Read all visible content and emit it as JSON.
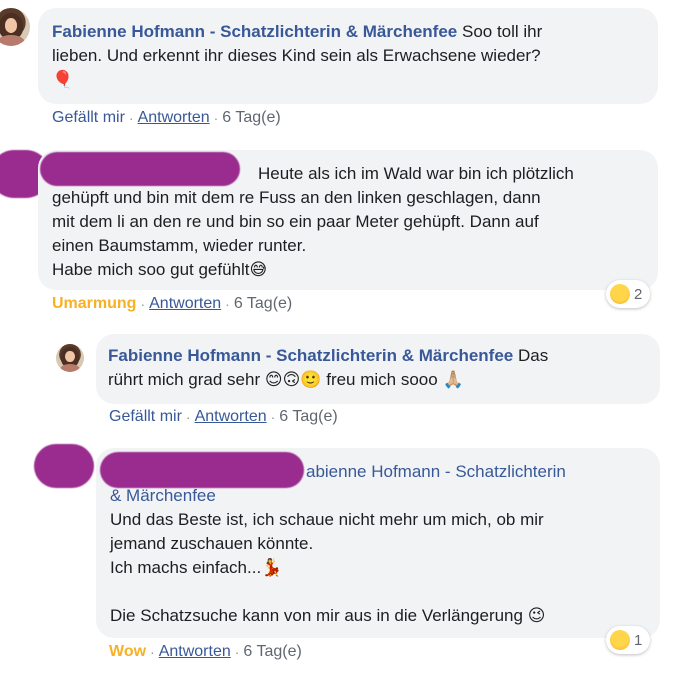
{
  "comments": [
    {
      "name": "Fabienne Hofmann - Schatzlichterin & Märchenfee",
      "text_line1": "Soo toll ihr",
      "text_line2": "lieben. Und erkennt ihr dieses Kind sein als Erwachsene wieder?",
      "emoji": "🎈",
      "reaction_label": "Gefällt mir",
      "reply_label": "Antworten",
      "time": "6 Tag(e)"
    },
    {
      "text_line1": "Heute als ich im Wald war bin ich plötzlich",
      "text_line2": "gehüpft und bin mit dem re Fuss an den linken geschlagen, dann",
      "text_line3": "mit dem li an den re und bin so ein paar Meter gehüpft. Dann auf",
      "text_line4": "einen Baumstamm, wieder runter.",
      "text_line5": "Habe mich soo gut gefühlt",
      "emoji": "😅",
      "reaction_label": "Umarmung",
      "reply_label": "Antworten",
      "time": "6 Tag(e)",
      "reaction_count": "2"
    },
    {
      "name": "Fabienne Hofmann - Schatzlichterin & Märchenfee",
      "text_line1": "Das",
      "text_line2_a": "rührt mich grad sehr",
      "emojis_a": "😊🙃🙂",
      "text_line2_b": "freu mich sooo",
      "emoji_b": "🙏🏼",
      "reaction_label": "Gefällt mir",
      "reply_label": "Antworten",
      "time": "6 Tag(e)"
    },
    {
      "mention_tail": "abienne Hofmann - Schatzlichterin",
      "mention_line2": "& Märchenfee",
      "text_line1": "Und das Beste ist, ich schaue nicht mehr um mich, ob mir",
      "text_line2": "jemand zuschauen könnte.",
      "text_line3": "Ich machs einfach...",
      "emoji_a": "💃",
      "text_line4": "Die Schatzsuche kann von mir aus in die Verlängerung",
      "emoji_b": "😉",
      "reaction_label": "Wow",
      "reply_label": "Antworten",
      "time": "6 Tag(e)",
      "reaction_count": "1"
    }
  ],
  "separator": "·"
}
